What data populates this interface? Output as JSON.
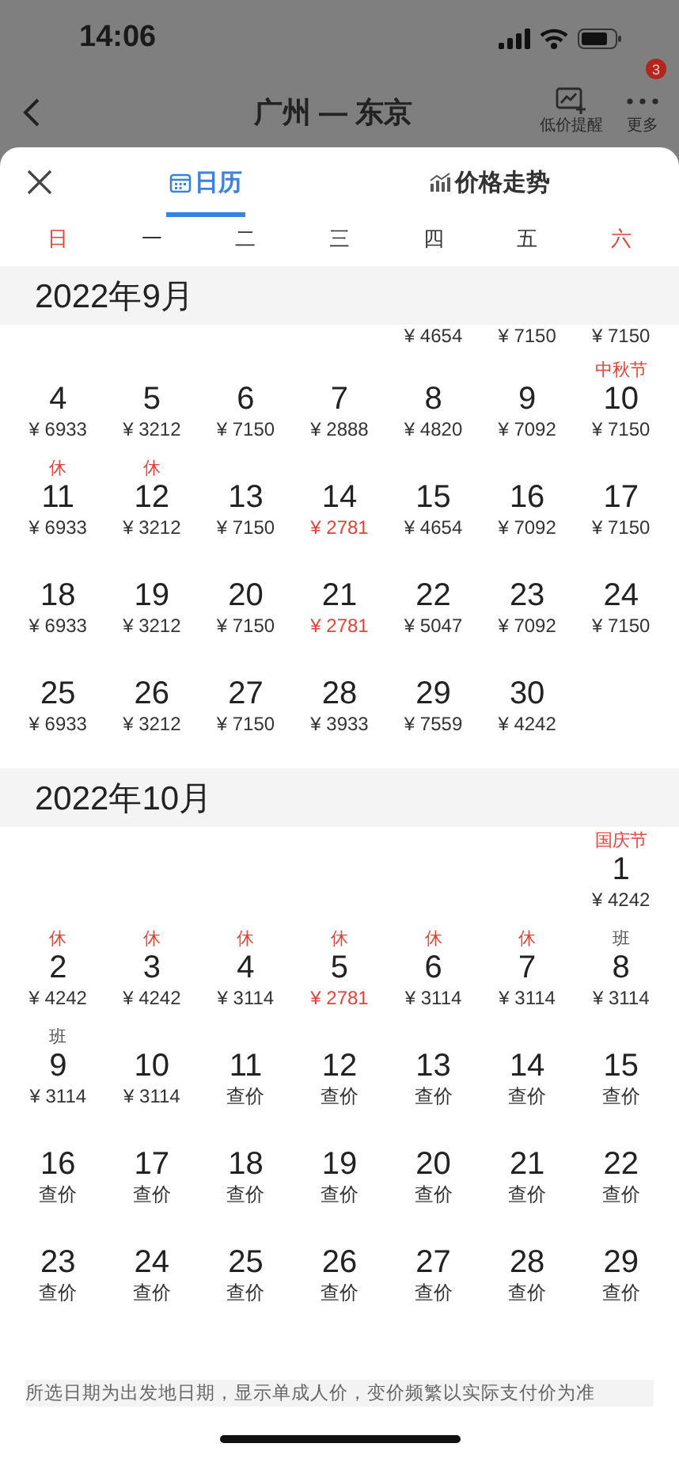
{
  "status_bar": {
    "time": "14:06"
  },
  "header": {
    "title": "广州 — 东京",
    "actions": [
      {
        "kind": "alert",
        "label": "低价提醒"
      },
      {
        "kind": "more",
        "label": "更多",
        "badge": "3"
      }
    ]
  },
  "tabs": [
    {
      "kind": "calendar",
      "label": "日历",
      "selected": true
    },
    {
      "kind": "trend",
      "label": "价格走势",
      "selected": false
    }
  ],
  "weekdays": [
    {
      "label": "日",
      "weekend": true
    },
    {
      "label": "一",
      "weekend": false
    },
    {
      "label": "二",
      "weekend": false
    },
    {
      "label": "三",
      "weekend": false
    },
    {
      "label": "四",
      "weekend": false
    },
    {
      "label": "五",
      "weekend": false
    },
    {
      "label": "六",
      "weekend": true
    }
  ],
  "months": [
    {
      "title": "2022年9月",
      "weeks": [
        [
          {
            "kind": "blank"
          },
          {
            "kind": "blank"
          },
          {
            "kind": "blank"
          },
          {
            "kind": "blank"
          },
          {
            "kind": "date",
            "price": "¥ 4654",
            "lowest": false
          },
          {
            "kind": "date",
            "price": "¥ 7150",
            "lowest": false
          },
          {
            "kind": "date",
            "price": "¥ 7150",
            "lowest": false
          }
        ],
        [
          {
            "kind": "date",
            "day": "4",
            "price": "¥ 6933",
            "lowest": false
          },
          {
            "kind": "date",
            "day": "5",
            "price": "¥ 3212",
            "lowest": false
          },
          {
            "kind": "date",
            "day": "6",
            "price": "¥ 7150",
            "lowest": false
          },
          {
            "kind": "date",
            "day": "7",
            "price": "¥ 2888",
            "lowest": false
          },
          {
            "kind": "date",
            "day": "8",
            "price": "¥ 4820",
            "lowest": false
          },
          {
            "kind": "date",
            "day": "9",
            "price": "¥ 7092",
            "lowest": false
          },
          {
            "kind": "date",
            "day": "10",
            "price": "¥ 7150",
            "lowest": false,
            "tag": {
              "text": "中秋节",
              "kind": "holiday"
            }
          }
        ],
        [
          {
            "kind": "date",
            "day": "11",
            "price": "¥ 6933",
            "lowest": false,
            "tag": {
              "text": "休",
              "kind": "holiday"
            }
          },
          {
            "kind": "date",
            "day": "12",
            "price": "¥ 3212",
            "lowest": false,
            "tag": {
              "text": "休",
              "kind": "holiday"
            }
          },
          {
            "kind": "date",
            "day": "13",
            "price": "¥ 7150",
            "lowest": false
          },
          {
            "kind": "date",
            "day": "14",
            "price": "¥ 2781",
            "lowest": true
          },
          {
            "kind": "date",
            "day": "15",
            "price": "¥ 4654",
            "lowest": false
          },
          {
            "kind": "date",
            "day": "16",
            "price": "¥ 7092",
            "lowest": false
          },
          {
            "kind": "date",
            "day": "17",
            "price": "¥ 7150",
            "lowest": false
          }
        ],
        [
          {
            "kind": "date",
            "day": "18",
            "price": "¥ 6933",
            "lowest": false
          },
          {
            "kind": "date",
            "day": "19",
            "price": "¥ 3212",
            "lowest": false
          },
          {
            "kind": "date",
            "day": "20",
            "price": "¥ 7150",
            "lowest": false
          },
          {
            "kind": "date",
            "day": "21",
            "price": "¥ 2781",
            "lowest": true
          },
          {
            "kind": "date",
            "day": "22",
            "price": "¥ 5047",
            "lowest": false
          },
          {
            "kind": "date",
            "day": "23",
            "price": "¥ 7092",
            "lowest": false
          },
          {
            "kind": "date",
            "day": "24",
            "price": "¥ 7150",
            "lowest": false
          }
        ],
        [
          {
            "kind": "date",
            "day": "25",
            "price": "¥ 6933",
            "lowest": false
          },
          {
            "kind": "date",
            "day": "26",
            "price": "¥ 3212",
            "lowest": false
          },
          {
            "kind": "date",
            "day": "27",
            "price": "¥ 7150",
            "lowest": false
          },
          {
            "kind": "date",
            "day": "28",
            "price": "¥ 3933",
            "lowest": false
          },
          {
            "kind": "date",
            "day": "29",
            "price": "¥ 7559",
            "lowest": false
          },
          {
            "kind": "date",
            "day": "30",
            "price": "¥ 4242",
            "lowest": false
          },
          {
            "kind": "blank"
          }
        ]
      ]
    },
    {
      "title": "2022年10月",
      "weeks": [
        [
          {
            "kind": "blank"
          },
          {
            "kind": "blank"
          },
          {
            "kind": "blank"
          },
          {
            "kind": "blank"
          },
          {
            "kind": "blank"
          },
          {
            "kind": "blank"
          },
          {
            "kind": "date",
            "day": "1",
            "price": "¥ 4242",
            "lowest": false,
            "tag": {
              "text": "国庆节",
              "kind": "holiday"
            }
          }
        ],
        [
          {
            "kind": "date",
            "day": "2",
            "price": "¥ 4242",
            "lowest": false,
            "tag": {
              "text": "休",
              "kind": "holiday"
            }
          },
          {
            "kind": "date",
            "day": "3",
            "price": "¥ 4242",
            "lowest": false,
            "tag": {
              "text": "休",
              "kind": "holiday"
            }
          },
          {
            "kind": "date",
            "day": "4",
            "price": "¥ 3114",
            "lowest": false,
            "tag": {
              "text": "休",
              "kind": "holiday"
            }
          },
          {
            "kind": "date",
            "day": "5",
            "price": "¥ 2781",
            "lowest": true,
            "tag": {
              "text": "休",
              "kind": "holiday"
            }
          },
          {
            "kind": "date",
            "day": "6",
            "price": "¥ 3114",
            "lowest": false,
            "tag": {
              "text": "休",
              "kind": "holiday"
            }
          },
          {
            "kind": "date",
            "day": "7",
            "price": "¥ 3114",
            "lowest": false,
            "tag": {
              "text": "休",
              "kind": "holiday"
            }
          },
          {
            "kind": "date",
            "day": "8",
            "price": "¥ 3114",
            "lowest": false,
            "tag": {
              "text": "班",
              "kind": "workday"
            }
          }
        ],
        [
          {
            "kind": "date",
            "day": "9",
            "price": "¥ 3114",
            "lowest": false,
            "tag": {
              "text": "班",
              "kind": "workday"
            }
          },
          {
            "kind": "date",
            "day": "10",
            "price": "¥ 3114",
            "lowest": false
          },
          {
            "kind": "date",
            "day": "11",
            "price": "查价",
            "lowest": false
          },
          {
            "kind": "date",
            "day": "12",
            "price": "查价",
            "lowest": false
          },
          {
            "kind": "date",
            "day": "13",
            "price": "查价",
            "lowest": false
          },
          {
            "kind": "date",
            "day": "14",
            "price": "查价",
            "lowest": false
          },
          {
            "kind": "date",
            "day": "15",
            "price": "查价",
            "lowest": false
          }
        ],
        [
          {
            "kind": "date",
            "day": "16",
            "price": "查价",
            "lowest": false
          },
          {
            "kind": "date",
            "day": "17",
            "price": "查价",
            "lowest": false
          },
          {
            "kind": "date",
            "day": "18",
            "price": "查价",
            "lowest": false
          },
          {
            "kind": "date",
            "day": "19",
            "price": "查价",
            "lowest": false
          },
          {
            "kind": "date",
            "day": "20",
            "price": "查价",
            "lowest": false
          },
          {
            "kind": "date",
            "day": "21",
            "price": "查价",
            "lowest": false
          },
          {
            "kind": "date",
            "day": "22",
            "price": "查价",
            "lowest": false
          }
        ],
        [
          {
            "kind": "date",
            "day": "23",
            "price": "查价",
            "lowest": false
          },
          {
            "kind": "date",
            "day": "24",
            "price": "查价",
            "lowest": false
          },
          {
            "kind": "date",
            "day": "25",
            "price": "查价",
            "lowest": false
          },
          {
            "kind": "date",
            "day": "26",
            "price": "查价",
            "lowest": false
          },
          {
            "kind": "date",
            "day": "27",
            "price": "查价",
            "lowest": false
          },
          {
            "kind": "date",
            "day": "28",
            "price": "查价",
            "lowest": false
          },
          {
            "kind": "date",
            "day": "29",
            "price": "查价",
            "lowest": false
          }
        ]
      ]
    }
  ],
  "footer_note": "所选日期为出发地日期，显示单成人价，变价频繁以实际支付价为准"
}
